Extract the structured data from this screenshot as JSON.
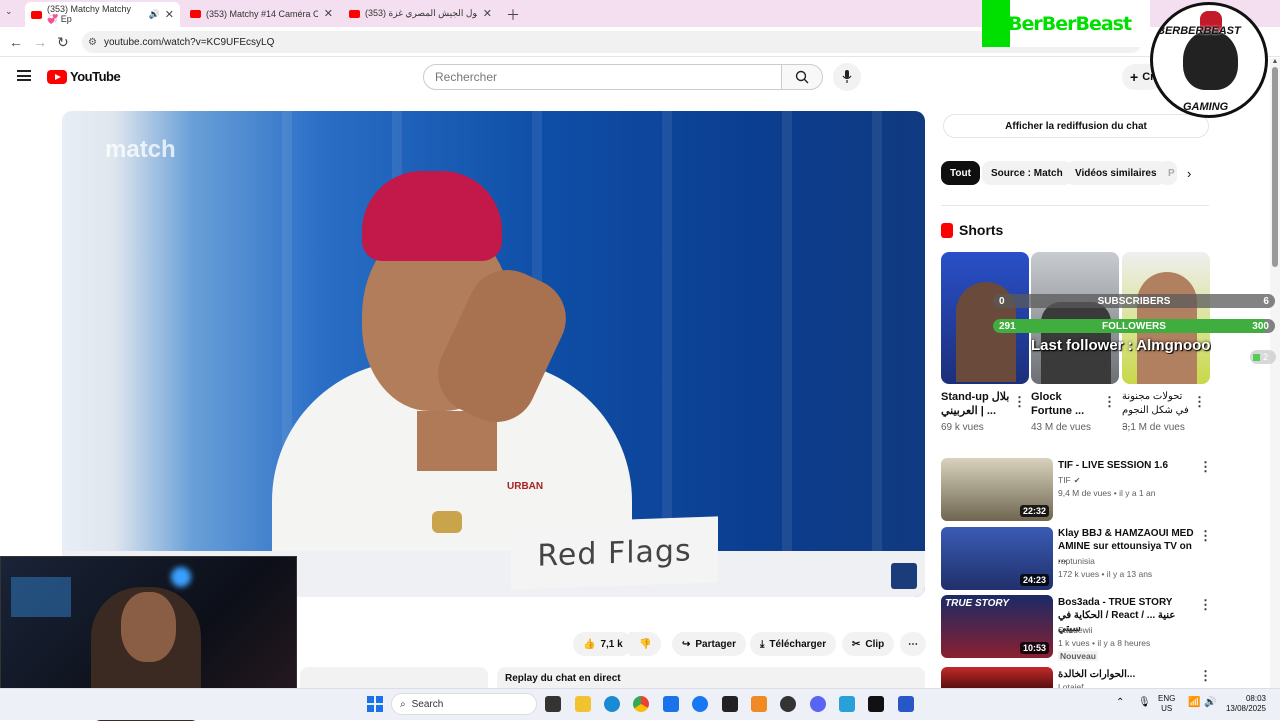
{
  "tabs": [
    {
      "title": "(353) Matchy Matchy 💞 Ep"
    },
    {
      "title": "(353) Matchy #14 Caméra Cach"
    },
    {
      "title": "(353) دخول الجيش المصري غزة"
    }
  ],
  "new_tab_icon": "plus-icon",
  "address": {
    "url": "youtube.com/watch?v=KC9UFEcsyLQ"
  },
  "youtube": {
    "logo_text": "YouTube",
    "search_placeholder": "Rechercher",
    "create_label": "Cr"
  },
  "video": {
    "placard_text": "Red Flags",
    "channel_watermark": "match",
    "shirt_text": "URBAN"
  },
  "actions": {
    "likes": "7,1 k",
    "share": "Partager",
    "download": "Télécharger",
    "clip": "Clip"
  },
  "chat_replay": {
    "show_label": "Afficher la rediffusion du chat",
    "bottom_label": "Replay du chat en direct"
  },
  "filters": [
    "Tout",
    "Source : Match",
    "Vidéos similaires",
    "P"
  ],
  "shorts": {
    "heading": "Shorts",
    "items": [
      {
        "title": "Stand-up بلال | العربيني ...",
        "views": "69 k vues"
      },
      {
        "title": "Glock Fortune ...",
        "views": "43 M de vues"
      },
      {
        "title": "تحولات مجنونة في شكل النجوم ...",
        "views": "3,1 M de vues"
      }
    ]
  },
  "videos": [
    {
      "title": "TIF - LIVE SESSION 1.6",
      "channel": "TIF",
      "meta": "9,4 M de vues • il y a 1 an",
      "duration": "22:32",
      "verified": true
    },
    {
      "title": "Klay BBJ & HAMZAOUI MED AMINE sur ettounsiya TV on ...",
      "channel": "raptunisia",
      "meta": "172 k vues • il y a 13 ans",
      "duration": "24:23"
    },
    {
      "title": "Bos3ada - TRUE STORY الحكاية في / React / ... عنية سيتي",
      "channel": "Saadewii",
      "meta": "1 k vues • il y a 8 heures",
      "badge": "Nouveau",
      "duration": "10:53",
      "thumb_text": "TRUE STORY"
    },
    {
      "title": "الحوارات الخالدة...",
      "channel": "Lotaief ...",
      "meta": ""
    }
  ],
  "stream_overlay": {
    "brand": "BerBerBeast",
    "badge_top": "BERBERBEAST",
    "badge_bottom": "GAMING",
    "subscribers_label": "SUBSCRIBERS",
    "subscribers_current": "0",
    "subscribers_goal": "6",
    "subscribers_progress": 0,
    "followers_label": "FOLLOWERS",
    "followers_current": "291",
    "followers_goal": "300",
    "followers_progress": 0.97,
    "last_follower": "Last follower : Almgnooon",
    "viewer_count": "2"
  },
  "taskbar": {
    "search": "Search",
    "lang_top": "ENG",
    "lang_bottom": "US",
    "time": "08:03",
    "date": "13/08/2025"
  },
  "colors": {
    "youtube_red": "#ff0000",
    "overlay_green": "#3fae3f",
    "brand_green": "#00e000",
    "tab_bg": "#f3dff0"
  }
}
